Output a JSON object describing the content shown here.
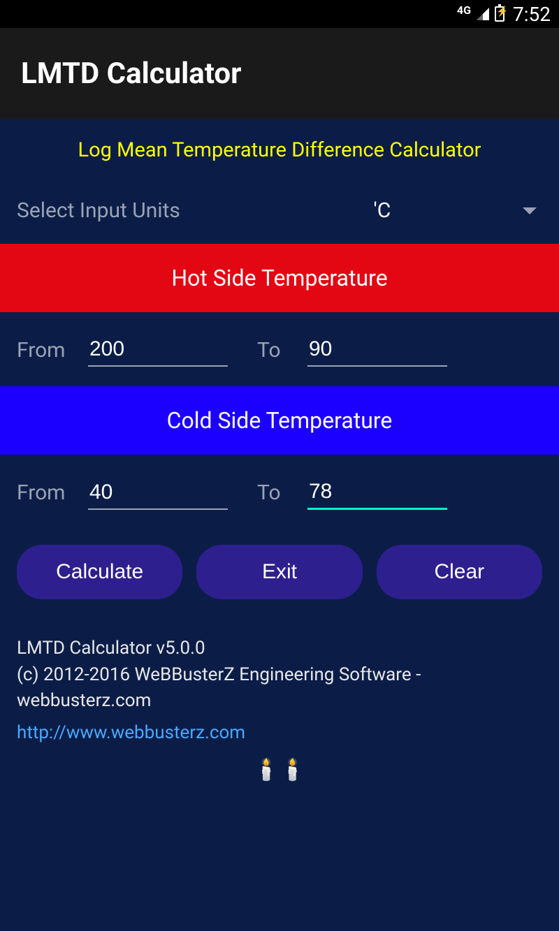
{
  "status_bar": {
    "network": "4G",
    "time": "7:52"
  },
  "app_bar": {
    "title": "LMTD Calculator"
  },
  "subtitle": "Log Mean Temperature Difference Calculator",
  "units": {
    "label": "Select Input Units",
    "selected": "'C"
  },
  "hot_section": {
    "header": "Hot Side Temperature",
    "from_label": "From",
    "from_value": "200",
    "to_label": "To",
    "to_value": "90"
  },
  "cold_section": {
    "header": "Cold Side Temperature",
    "from_label": "From",
    "from_value": "40",
    "to_label": "To",
    "to_value": "78"
  },
  "buttons": {
    "calculate": "Calculate",
    "exit": "Exit",
    "clear": "Clear"
  },
  "footer": {
    "version": "LMTD Calculator v5.0.0",
    "copyright": "(c) 2012-2016 WeBBusterZ Engineering Software - webbusterz.com",
    "link": "http://www.webbusterz.com"
  }
}
